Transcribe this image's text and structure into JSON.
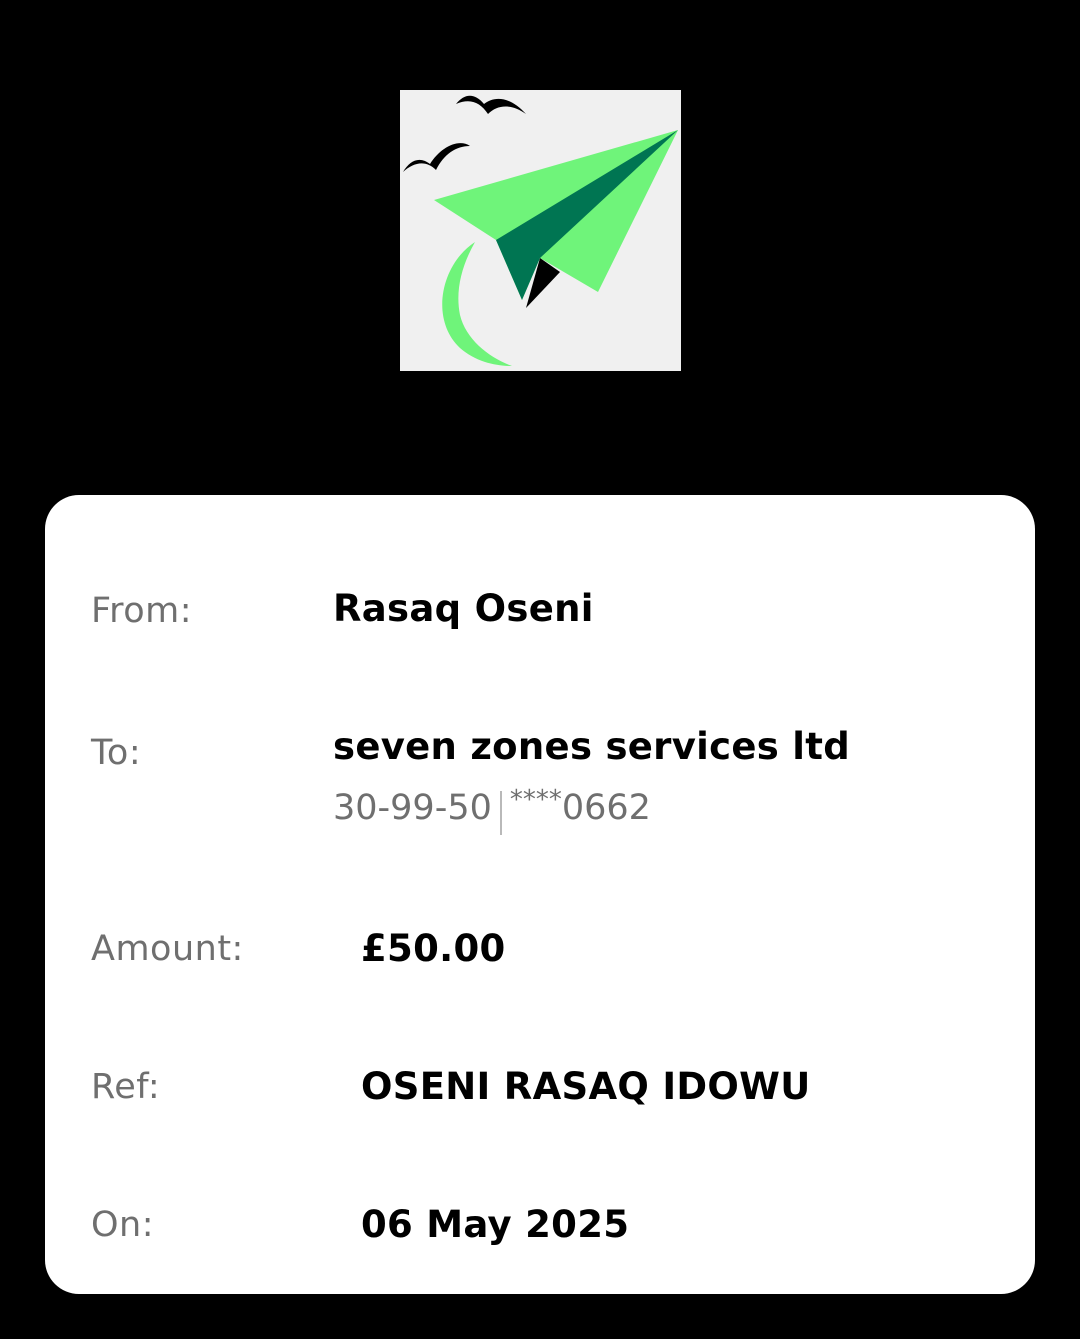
{
  "logo": {
    "icon": "paper-plane-logo",
    "colors": {
      "background": "#f0f0f0",
      "plane_light": "#6ff47a",
      "plane_dark": "#007552",
      "birds": "#000000"
    }
  },
  "receipt": {
    "from": {
      "label": "From:",
      "value": "Rasaq Oseni"
    },
    "to": {
      "label": "To:",
      "value": "seven zones services ltd",
      "sort_code": "30-99-50",
      "account_mask": "****",
      "account_last4": "0662"
    },
    "amount": {
      "label": "Amount:",
      "value": "£50.00"
    },
    "ref": {
      "label": "Ref:",
      "value": "OSENI RASAQ IDOWU"
    },
    "on": {
      "label": "On:",
      "value": "06 May 2025"
    }
  }
}
